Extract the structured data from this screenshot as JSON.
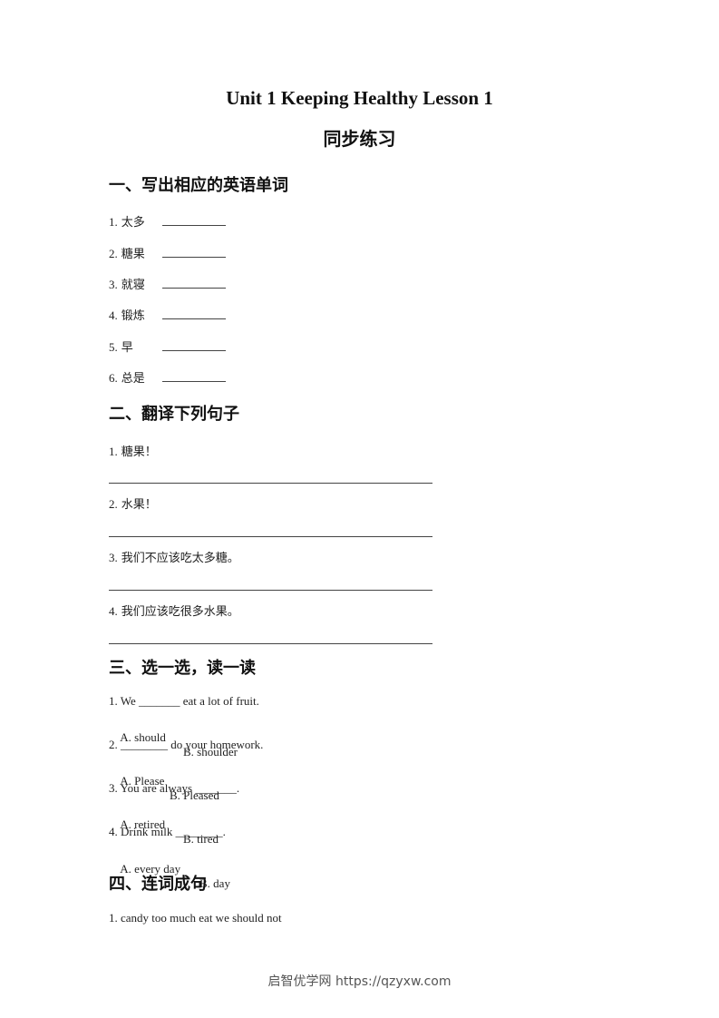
{
  "document": {
    "title_en": "Unit 1 Keeping Healthy Lesson 1",
    "title_zh": "同步练习"
  },
  "section1": {
    "heading": "一、写出相应的英语单词",
    "items": [
      {
        "num": "1.",
        "text": "太多"
      },
      {
        "num": "2.",
        "text": "糖果"
      },
      {
        "num": "3.",
        "text": "就寝"
      },
      {
        "num": "4.",
        "text": "锻炼"
      },
      {
        "num": "5.",
        "text": "早"
      },
      {
        "num": "6.",
        "text": "总是"
      }
    ]
  },
  "section2": {
    "heading": "二、翻译下列句子",
    "items": [
      {
        "num": "1.",
        "text": "糖果！"
      },
      {
        "num": "2.",
        "text": "水果！"
      },
      {
        "num": "3.",
        "text": "我们不应该吃太多糖。"
      },
      {
        "num": "4.",
        "text": "我们应该吃很多水果。"
      }
    ]
  },
  "section3": {
    "heading": "三、选一选，读一读",
    "items": [
      {
        "question": "1. We _______ eat a lot of fruit.",
        "option_a": "A. should",
        "option_b": "B. shoulder"
      },
      {
        "question": "2. ________ do your homework.",
        "option_a": "A. Please",
        "option_b": "B. Pleased"
      },
      {
        "question": "3. You are always _______.",
        "option_a": "A. retired",
        "option_b": "B. tired"
      },
      {
        "question": "4. Drink milk ________.",
        "option_a": "A. every day",
        "option_b": "B. day"
      }
    ]
  },
  "section4": {
    "heading": "四、连词成句",
    "items": [
      {
        "text": "1. candy too much eat we should not"
      }
    ]
  },
  "footer": {
    "text": "启智优学网 https://qzyxw.com"
  }
}
